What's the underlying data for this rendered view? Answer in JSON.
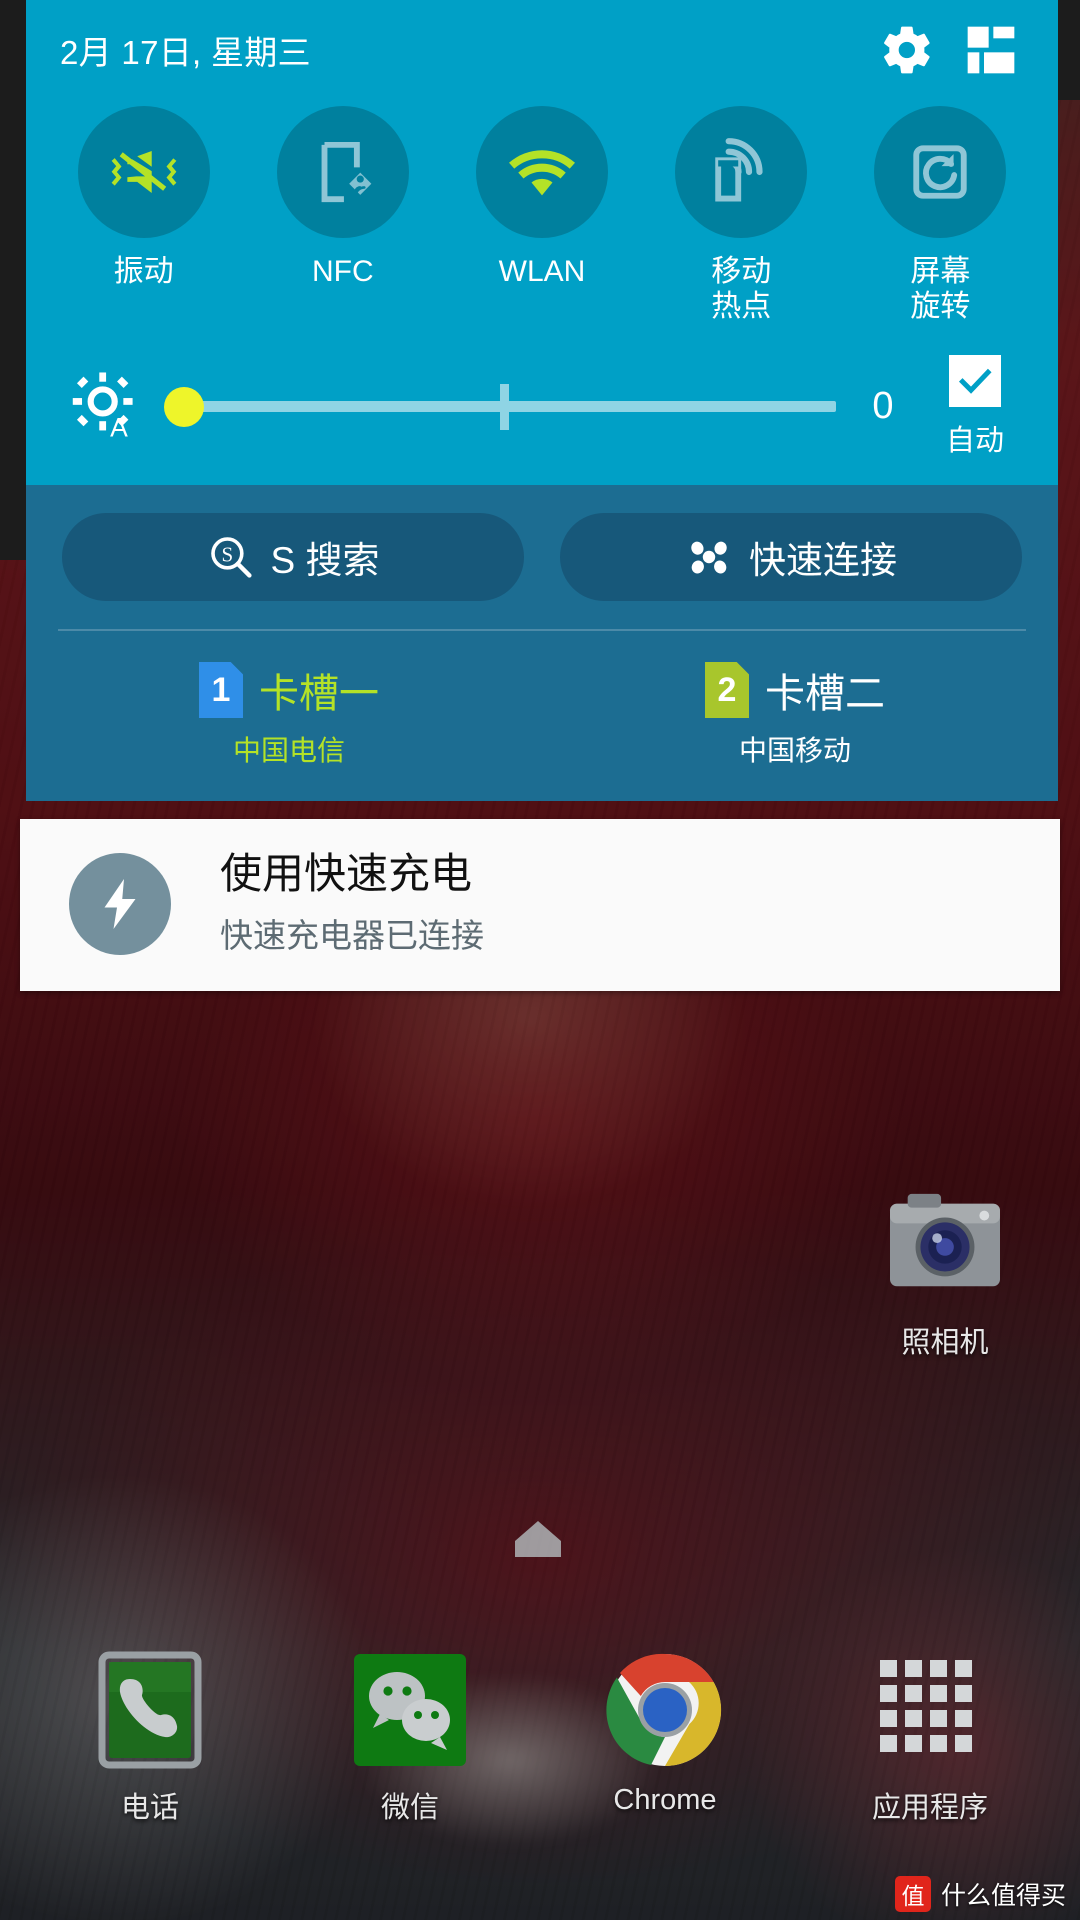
{
  "statusbar": {
    "date": "2月 17日, 星期三",
    "settings_icon": "gear-icon",
    "edit_icon": "quick-settings-edit-icon"
  },
  "quick_settings": {
    "toggles": [
      {
        "label": "振动",
        "icon": "vibrate-icon",
        "active": true
      },
      {
        "label": "NFC",
        "icon": "nfc-icon",
        "active": false
      },
      {
        "label": "WLAN",
        "icon": "wifi-icon",
        "active": true
      },
      {
        "label": "移动\n热点",
        "icon": "mobile-hotspot-icon",
        "active": false
      },
      {
        "label": "屏幕\n旋转",
        "icon": "screen-rotation-icon",
        "active": false
      }
    ],
    "brightness": {
      "icon": "brightness-auto-icon",
      "value": "0",
      "auto_label": "自动",
      "auto_checked": true,
      "thumb_percent": 0,
      "tick_percent": 50
    },
    "buttons": [
      {
        "label": "S 搜索",
        "icon": "s-search-icon"
      },
      {
        "label": "快速连接",
        "icon": "quick-connect-icon"
      }
    ],
    "sim_slots": [
      {
        "badge": "1",
        "name": "卡槽一",
        "carrier": "中国电信",
        "badge_color": "#2f8fe8",
        "name_color": "#b4e227",
        "carrier_color": "#b4e227"
      },
      {
        "badge": "2",
        "name": "卡槽二",
        "carrier": "中国移动",
        "badge_color": "#a8c62c",
        "name_color": "#ffffff",
        "carrier_color": "#ffffff"
      }
    ]
  },
  "notification": {
    "icon": "fast-charging-bolt-icon",
    "title": "使用快速充电",
    "subtitle": "快速充电器已连接"
  },
  "home": {
    "apps": [
      {
        "id": "camera",
        "label": "照相机",
        "icon": "camera-icon"
      },
      {
        "id": "phone",
        "label": "电话",
        "icon": "phone-icon"
      },
      {
        "id": "wechat",
        "label": "微信",
        "icon": "wechat-icon"
      },
      {
        "id": "chrome",
        "label": "Chrome",
        "icon": "chrome-icon"
      },
      {
        "id": "drawer",
        "label": "应用程序",
        "icon": "app-drawer-icon"
      }
    ],
    "home_indicator": "home-indicator-icon"
  },
  "watermark": {
    "badge": "值",
    "text": "什么值得买"
  },
  "colors": {
    "panel_top": "#00a0c6",
    "panel_bottom": "#1c6d92",
    "toggle_circle": "#00809e",
    "accent_active": "#b4e227",
    "accent_inactive": "#8fc6d6",
    "slider_thumb": "#eef52a",
    "notif_bg": "#fafafa"
  }
}
